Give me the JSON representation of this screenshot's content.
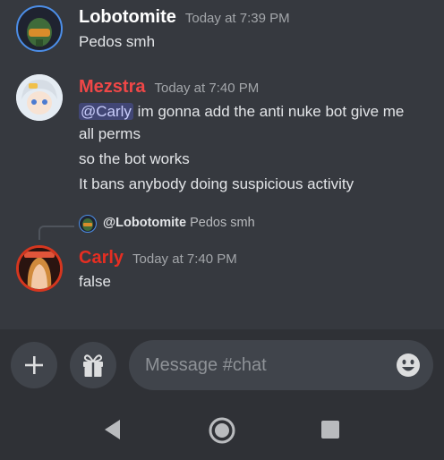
{
  "messages": [
    {
      "username": "Lobotomite",
      "name_color": "#ffffff",
      "timestamp": "Today at 7:39 PM",
      "lines": [
        "Pedos smh"
      ]
    },
    {
      "username": "Mezstra",
      "name_color": "#f04747",
      "timestamp": "Today at 7:40 PM",
      "mention": "@Carly",
      "lines": [
        " im gonna add the anti nuke bot give me",
        "all perms",
        "so the bot works",
        "It bans anybody doing suspicious activity"
      ]
    },
    {
      "username": "Carly",
      "name_color": "#e62e22",
      "timestamp": "Today at 7:40 PM",
      "reply": {
        "mention": "@Lobotomite",
        "text": "Pedos smh"
      },
      "lines": [
        "false"
      ]
    }
  ],
  "composer": {
    "placeholder": "Message #chat",
    "add_icon": "plus-icon",
    "gift_icon": "gift-icon",
    "emoji_icon": "emoji-icon"
  },
  "navbar": {
    "back_icon": "triangle-back-icon",
    "home_icon": "circle-home-icon",
    "recents_icon": "square-recents-icon"
  },
  "colors": {
    "background": "#36393f",
    "composer": "#2f3136",
    "mention_bg": "#414675"
  }
}
